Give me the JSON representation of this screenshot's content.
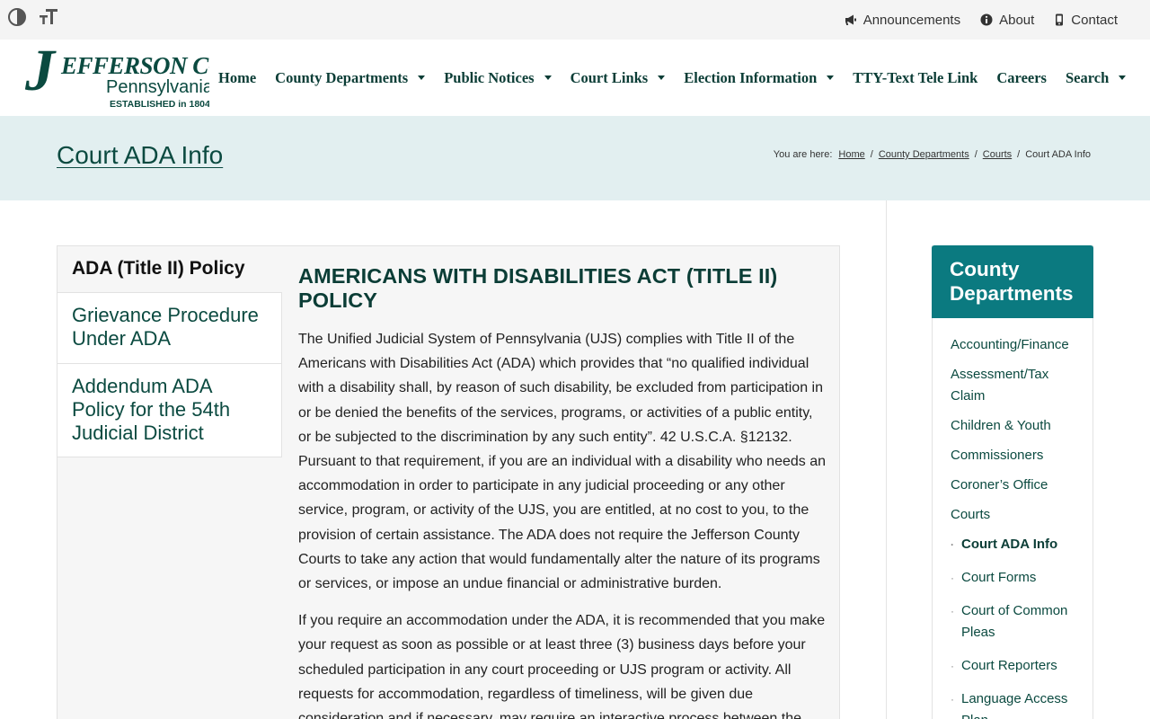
{
  "topbar": {
    "links": [
      {
        "label": "Announcements",
        "icon": "megaphone-icon"
      },
      {
        "label": "About",
        "icon": "info-icon"
      },
      {
        "label": "Contact",
        "icon": "phone-icon"
      }
    ],
    "tools": [
      "contrast-icon",
      "text-size-icon"
    ]
  },
  "logo": {
    "initial": "J",
    "name": "EFFERSON COUNTY",
    "state": "Pennsylvania",
    "established": "ESTABLISHED in 1804"
  },
  "nav": [
    {
      "label": "Home",
      "dropdown": false
    },
    {
      "label": "County Departments",
      "dropdown": true
    },
    {
      "label": "Public Notices",
      "dropdown": true
    },
    {
      "label": "Court Links",
      "dropdown": true
    },
    {
      "label": "Election Information",
      "dropdown": true
    },
    {
      "label": "TTY-Text Tele Link",
      "dropdown": false
    },
    {
      "label": "Careers",
      "dropdown": false
    },
    {
      "label": "Search",
      "dropdown": true
    }
  ],
  "page": {
    "title": "Court ADA Info",
    "breadcrumb": {
      "prefix": "You are here:",
      "items": [
        "Home",
        "County Departments",
        "Courts"
      ],
      "current": "Court ADA Info",
      "separator": "/"
    }
  },
  "tabs": [
    {
      "label": "ADA (Title II) Policy",
      "active": true
    },
    {
      "label": "Grievance Procedure Under ADA",
      "active": false
    },
    {
      "label": "Addendum ADA Policy for the 54th Judicial District",
      "active": false
    }
  ],
  "panel": {
    "heading": "AMERICANS WITH DISABILITIES ACT (TITLE II) POLICY",
    "paragraphs": [
      "The Unified Judicial System of Pennsylvania (UJS) complies with Title II of the Americans with Disabilities Act (ADA) which provides that “no qualified individual with a disability shall, by reason of such disability, be excluded from participation in or be denied the benefits of the services, programs, or activities of a public entity, or be subjected to the discrimination by any such entity”. 42 U.S.C.A. §12132. Pursuant to that requirement, if you are an individual with a disability who needs an accommodation in order to participate in any judicial proceeding or any other service, program, or activity of the UJS, you are entitled, at no cost to you, to the provision of certain assistance. The ADA does not require the Jefferson County Courts to take any action that would fundamentally alter the nature of its programs or services, or impose an undue financial or administrative burden.",
      "If you require an accommodation under the ADA, it is recommended that you make your request as soon as possible or at least three (3) business days before your scheduled participation in any court proceeding or UJS program or activity. All requests for accommodation, regardless of timeliness, will be given due consideration and if necessary, may require an interactive process between the"
    ]
  },
  "sidebar": {
    "title": "County Departments",
    "items": [
      {
        "label": "Accounting/Finance",
        "sub": false
      },
      {
        "label": "Assessment/Tax Claim",
        "sub": false
      },
      {
        "label": "Children & Youth",
        "sub": false
      },
      {
        "label": "Commissioners",
        "sub": false
      },
      {
        "label": "Coroner’s Office",
        "sub": false
      },
      {
        "label": "Courts",
        "sub": false
      },
      {
        "label": "Court ADA Info",
        "sub": true,
        "current": true
      },
      {
        "label": "Court Forms",
        "sub": true
      },
      {
        "label": "Court of Common Pleas",
        "sub": true
      },
      {
        "label": "Court Reporters",
        "sub": true
      },
      {
        "label": "Language Access Plan",
        "sub": true
      }
    ]
  },
  "colors": {
    "brand_dark": "#0b4a40",
    "brand_teal": "#0b7a80",
    "band_bg": "#e2eff0",
    "topbar_bg": "#f4f4f4"
  }
}
